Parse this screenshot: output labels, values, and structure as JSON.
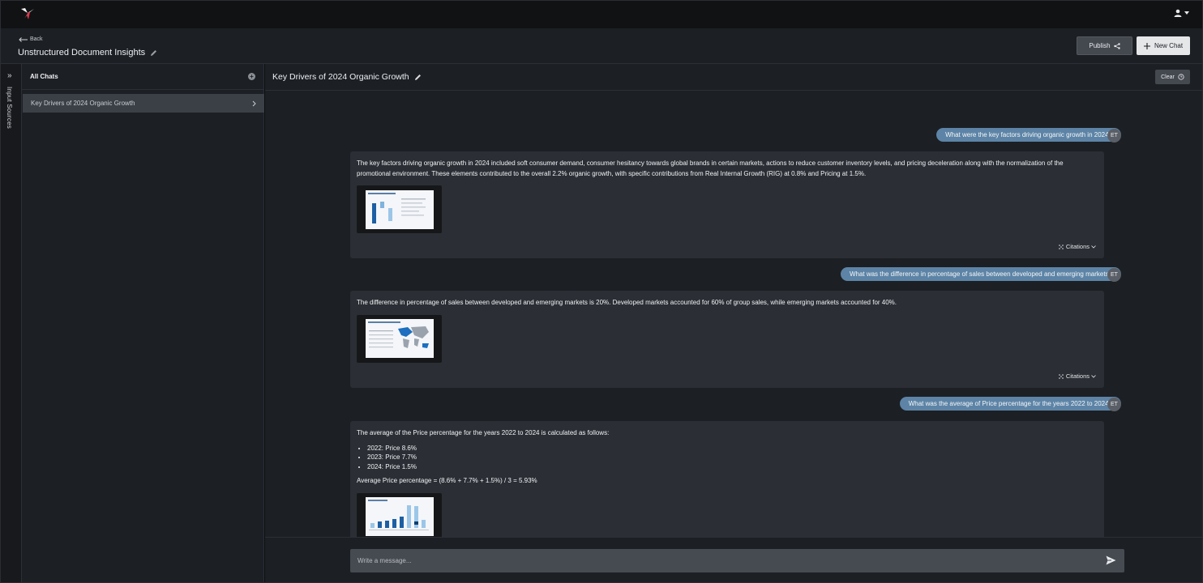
{
  "header": {
    "back_label": "Back",
    "title": "Unstructured Document Insights",
    "publish_label": "Publish",
    "new_chat_label": "New Chat"
  },
  "rail": {
    "label": "Input Sources"
  },
  "sidebar": {
    "title": "All Chats",
    "items": [
      {
        "label": "Key Drivers of 2024 Organic Growth"
      }
    ]
  },
  "chat": {
    "title": "Key Drivers of 2024 Organic Growth",
    "clear_label": "Clear",
    "user_initials": "ET",
    "citations_label": "Citations",
    "messages": [
      {
        "role": "user",
        "text": "What were the key factors driving organic growth in 2024?"
      },
      {
        "role": "assistant",
        "text": "The key factors driving organic growth in 2024 included soft consumer demand, consumer hesitancy towards global brands in certain markets, actions to reduce customer inventory levels, and pricing deceleration along with the normalization of the promotional environment. These elements contributed to the overall 2.2% organic growth, with specific contributions from Real Internal Growth (RIG) at 0.8% and Pricing at 1.5%."
      },
      {
        "role": "user",
        "text": "What was the difference in percentage of sales between developed and emerging markets?"
      },
      {
        "role": "assistant",
        "text": "The difference in percentage of sales between developed and emerging markets is 20%. Developed markets accounted for 60% of group sales, while emerging markets accounted for 40%."
      },
      {
        "role": "user",
        "text": "What was the average of Price percentage for the years 2022 to 2024?"
      },
      {
        "role": "assistant",
        "intro": "The average of the Price percentage for the years 2022 to 2024 is calculated as follows:",
        "bullets": [
          "2022: Price 8.6%",
          "2023: Price 7.7%",
          "2024: Price 1.5%"
        ],
        "formula": "Average Price percentage = (8.6% + 7.7% + 1.5%) / 3 = 5.93%"
      }
    ]
  },
  "composer": {
    "placeholder": "Write a message..."
  },
  "colors": {
    "accent_bubble": "#5d84a6",
    "logo_red": "#e3344a"
  }
}
